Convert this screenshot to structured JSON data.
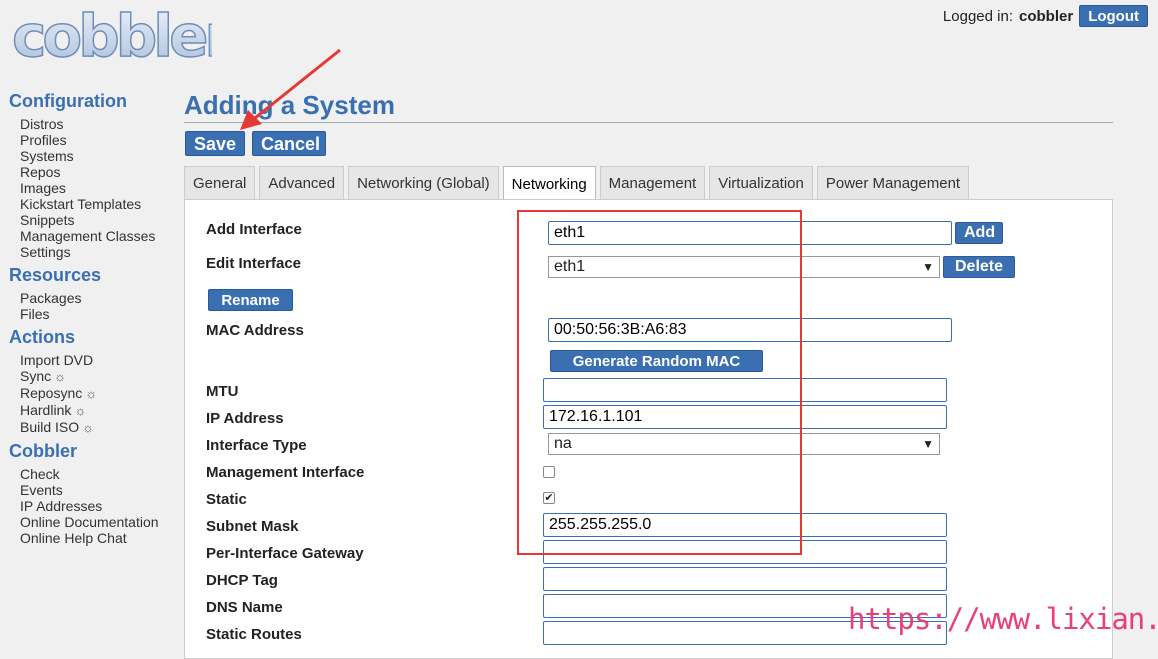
{
  "logo": {
    "text": "cobbler"
  },
  "header": {
    "logged_in_label": "Logged in:",
    "user": "cobbler",
    "logout_label": "Logout"
  },
  "sidebar": {
    "sections": [
      {
        "title": "Configuration",
        "items": [
          "Distros",
          "Profiles",
          "Systems",
          "Repos",
          "Images",
          "Kickstart Templates",
          "Snippets",
          "Management Classes",
          "Settings"
        ]
      },
      {
        "title": "Resources",
        "items": [
          "Packages",
          "Files"
        ]
      },
      {
        "title": "Actions",
        "items": [
          "Import DVD",
          "Sync",
          "Reposync",
          "Hardlink",
          "Build ISO"
        ]
      },
      {
        "title": "Cobbler",
        "items": [
          "Check",
          "Events",
          "IP Addresses",
          "Online Documentation",
          "Online Help Chat"
        ]
      }
    ]
  },
  "page": {
    "title": "Adding a System",
    "save_label": "Save",
    "cancel_label": "Cancel"
  },
  "tabs": [
    "General",
    "Advanced",
    "Networking (Global)",
    "Networking",
    "Management",
    "Virtualization",
    "Power Management"
  ],
  "form": {
    "add_interface": {
      "label": "Add Interface",
      "value": "eth1",
      "button": "Add"
    },
    "edit_interface": {
      "label": "Edit Interface",
      "value": "eth1",
      "button": "Delete"
    },
    "rename_button": "Rename",
    "mac": {
      "label": "MAC Address",
      "value": "00:50:56:3B:A6:83",
      "button": "Generate Random MAC"
    },
    "mtu": {
      "label": "MTU",
      "value": ""
    },
    "ip": {
      "label": "IP Address",
      "value": "172.16.1.101"
    },
    "interface_type": {
      "label": "Interface Type",
      "value": "na"
    },
    "management_interface": {
      "label": "Management Interface",
      "checked": false
    },
    "static": {
      "label": "Static",
      "checked": true
    },
    "subnet_mask": {
      "label": "Subnet Mask",
      "value": "255.255.255.0"
    },
    "gateway": {
      "label": "Per-Interface Gateway",
      "value": ""
    },
    "dhcp_tag": {
      "label": "DHCP Tag",
      "value": ""
    },
    "dns_name": {
      "label": "DNS Name",
      "value": ""
    },
    "static_routes": {
      "label": "Static Routes",
      "value": ""
    }
  },
  "watermark": "https://www.lixian.fun",
  "colors": {
    "accent": "#3a6fb2",
    "highlight": "#e53935",
    "watermark": "#e8407a"
  }
}
